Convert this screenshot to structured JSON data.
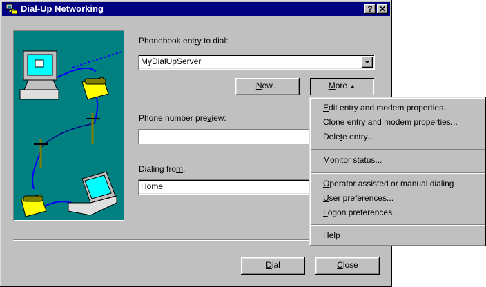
{
  "window": {
    "title": "Dial-Up Networking",
    "help_glyph": "?",
    "close_glyph": "✕"
  },
  "phonebook": {
    "label_pre": "Phonebook ent",
    "label_key": "r",
    "label_post": "y to dial:",
    "value": "MyDialUpServer"
  },
  "buttons": {
    "new_key": "N",
    "new_rest": "ew...",
    "more_key": "M",
    "more_rest": "ore",
    "more_arrow": "▲",
    "dial_key": "D",
    "dial_rest": "ial",
    "close_key": "C",
    "close_rest": "lose"
  },
  "preview": {
    "label_pre": "Phone number pre",
    "label_key": "v",
    "label_post": "iew:",
    "value": ""
  },
  "dialing_from": {
    "label_pre": "Dialing fro",
    "label_key": "m",
    "label_post": ":",
    "value": "Home"
  },
  "menu": {
    "items": [
      {
        "pre": "",
        "key": "E",
        "post": "dit entry and modem properties..."
      },
      {
        "pre": "Clone entry ",
        "key": "a",
        "post": "nd modem properties..."
      },
      {
        "pre": "Dele",
        "key": "t",
        "post": "e entry..."
      },
      {
        "pre": "Moni",
        "key": "t",
        "post": "or status..."
      },
      {
        "pre": "",
        "key": "O",
        "post": "perator assisted or manual dialing"
      },
      {
        "pre": "",
        "key": "U",
        "post": "ser preferences..."
      },
      {
        "pre": "",
        "key": "L",
        "post": "ogon preferences..."
      },
      {
        "pre": "",
        "key": "H",
        "post": "elp"
      }
    ]
  },
  "colors": {
    "titlebar": "#000080",
    "face": "#c0c0c0",
    "illustration_bg": "#008080"
  }
}
